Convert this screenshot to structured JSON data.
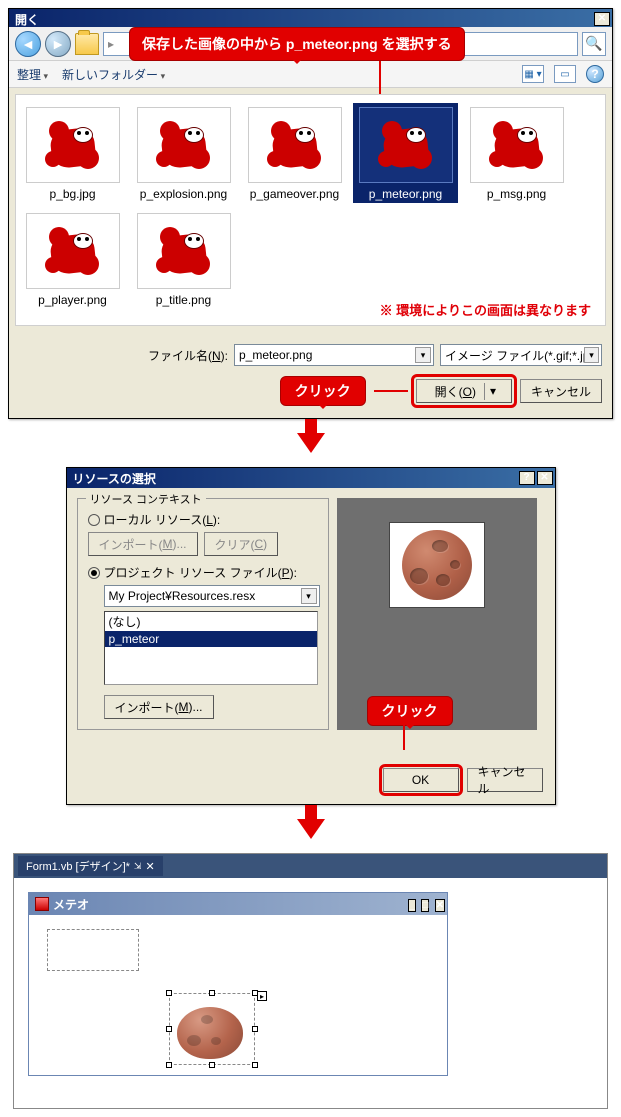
{
  "open_dialog": {
    "title": "開く",
    "toolbar": {
      "organize": "整理",
      "new_folder": "新しいフォルダー"
    },
    "files": [
      {
        "name": "p_bg.jpg"
      },
      {
        "name": "p_explosion.png"
      },
      {
        "name": "p_gameover.png"
      },
      {
        "name": "p_meteor.png",
        "selected": true
      },
      {
        "name": "p_msg.png"
      },
      {
        "name": "p_player.png"
      },
      {
        "name": "p_title.png"
      }
    ],
    "env_note": "※ 環境によりこの画面は異なります",
    "filename_label_pre": "ファイル名(",
    "filename_label_u": "N",
    "filename_label_post": "):",
    "filename_value": "p_meteor.png",
    "filter_value": "イメージ ファイル(*.gif;*.jpg",
    "open_btn_pre": "開く(",
    "open_btn_u": "O",
    "open_btn_post": ")",
    "cancel_btn": "キャンセル"
  },
  "annotations": {
    "select_saved": "保存した画像の中から p_meteor.png を選択する",
    "click": "クリック"
  },
  "resource_dialog": {
    "title": "リソースの選択",
    "group_label": "リソース コンテキスト",
    "local_pre": "ローカル リソース(",
    "local_u": "L",
    "local_post": "):",
    "import_btn_pre": "インポート(",
    "import_btn_u": "M",
    "import_btn_post": ")...",
    "clear_btn_pre": "クリア(",
    "clear_btn_u": "C",
    "clear_btn_post": ")",
    "project_pre": "プロジェクト リソース ファイル(",
    "project_u": "P",
    "project_post": "):",
    "project_combo": "My Project¥Resources.resx",
    "list_none": "(なし)",
    "list_item": "p_meteor",
    "import2_pre": "インポート(",
    "import2_u": "M",
    "import2_post": ")...",
    "ok_btn": "OK",
    "cancel_btn": "キャンセル"
  },
  "designer": {
    "tab_label": "Form1.vb [デザイン]*",
    "form_title": "メテオ"
  }
}
